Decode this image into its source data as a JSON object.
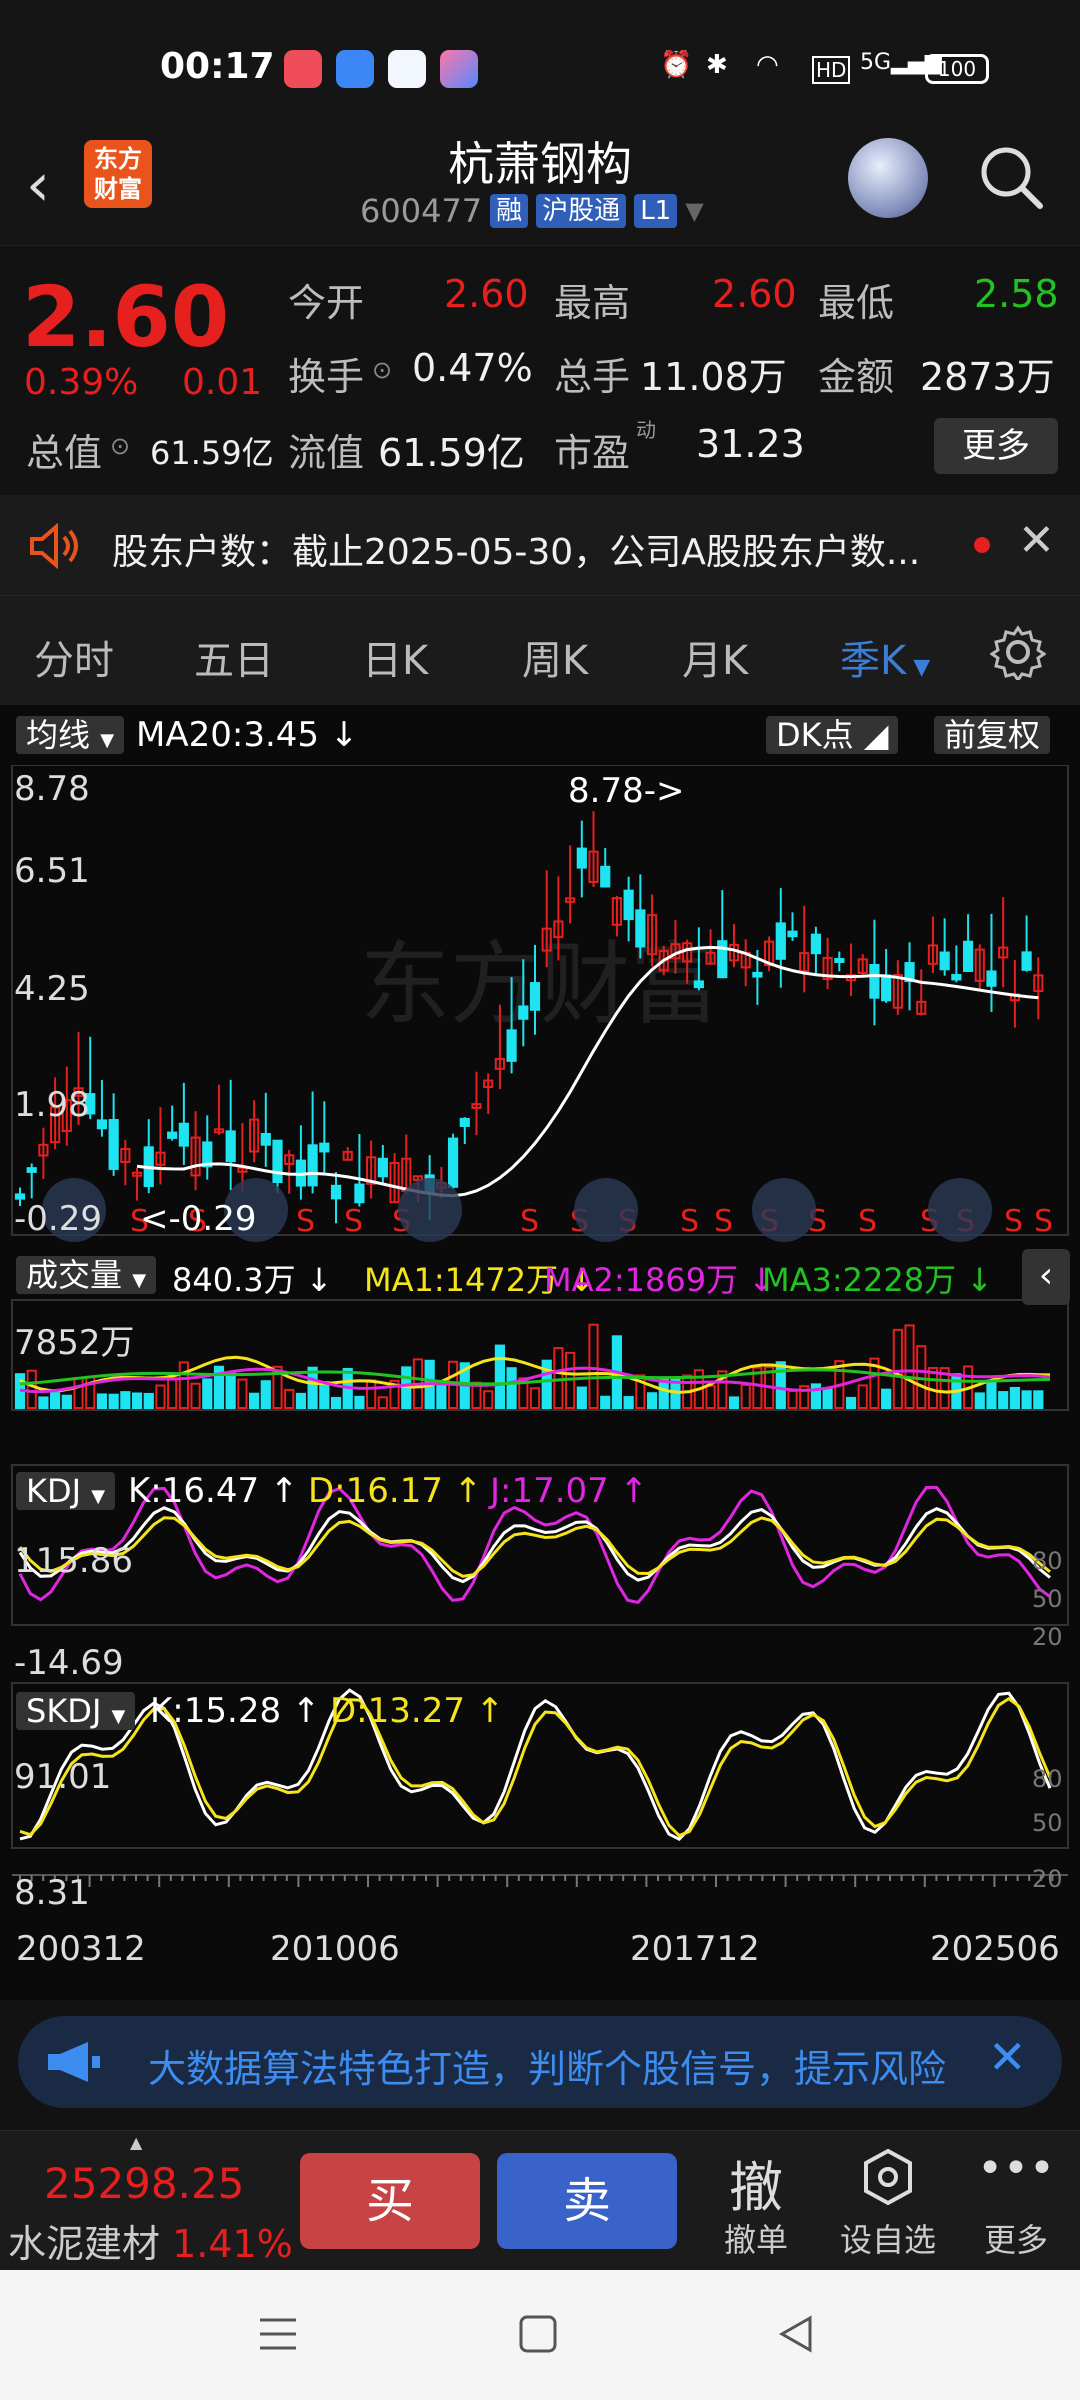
{
  "status": {
    "time": "00:17",
    "battery": "100",
    "network": "5G"
  },
  "header": {
    "logo_text": "东方财富",
    "title": "杭萧钢构",
    "code": "600477",
    "tags": [
      "融",
      "沪股通",
      "L1"
    ]
  },
  "quote": {
    "price": "2.60",
    "change_pct": "0.39%",
    "change": "0.01",
    "rows": [
      [
        {
          "label": "今开",
          "value": "2.60",
          "color": "red"
        },
        {
          "label": "最高",
          "value": "2.60",
          "color": "red"
        },
        {
          "label": "最低",
          "value": "2.58",
          "color": "green"
        }
      ],
      [
        {
          "label": "换手",
          "value": "0.47%",
          "color": "white"
        },
        {
          "label": "总手",
          "value": "11.08万",
          "color": "white"
        },
        {
          "label": "金额",
          "value": "2873万",
          "color": "white"
        }
      ],
      [
        {
          "label": "流值",
          "value": "61.59亿",
          "color": "white"
        },
        {
          "label": "市盈",
          "value": "31.23",
          "color": "white"
        }
      ]
    ],
    "total_value_label": "总值",
    "total_value": "61.59亿",
    "more": "更多",
    "pe_sup": "动"
  },
  "notice": {
    "text": "股东户数：截止2025-05-30，公司A股股东户数..."
  },
  "tabs": [
    "分时",
    "五日",
    "日K",
    "周K",
    "月K",
    "季K"
  ],
  "active_tab": "季K",
  "chart": {
    "ma_select": "均线",
    "ma20": "MA20:3.45",
    "dk": "DK点",
    "adjust": "前复权",
    "price_axis": [
      "8.78",
      "6.51",
      "4.25",
      "1.98",
      "-0.29"
    ],
    "max_label": "8.78->",
    "min_label": "<-0.29",
    "watermark": "东方财富",
    "volume": {
      "select": "成交量",
      "val": "840.3万",
      "ma1": "MA1:1472万",
      "ma2": "MA2:1869万",
      "ma3": "MA3:2228万",
      "axis_top": "7852万"
    },
    "kdj": {
      "select": "KDJ",
      "k": "K:16.47",
      "d": "D:16.17",
      "j": "J:17.07",
      "top": "115.86",
      "bottom": "-14.69",
      "levels": [
        "80",
        "50",
        "20"
      ]
    },
    "skdj": {
      "select": "SKDJ",
      "k": "K:15.28",
      "d": "D:13.27",
      "top": "91.01",
      "bottom": "8.31",
      "levels": [
        "80",
        "50",
        "20"
      ]
    },
    "dates": [
      "200312",
      "201006",
      "201712",
      "202506"
    ]
  },
  "banner": {
    "text": "大数据算法特色打造，判断个股信号，提示风险"
  },
  "trade": {
    "index_value": "25298.25",
    "index_name": "水泥建材",
    "index_pct": "1.41%",
    "buy": "买",
    "sell": "卖",
    "cancel_icon": "撤",
    "cancel": "撤单",
    "watch": "设自选",
    "more": "更多"
  },
  "colors": {
    "up": "#e61f1f",
    "down": "#1ee3f0",
    "accent": "#3b7dd8"
  }
}
